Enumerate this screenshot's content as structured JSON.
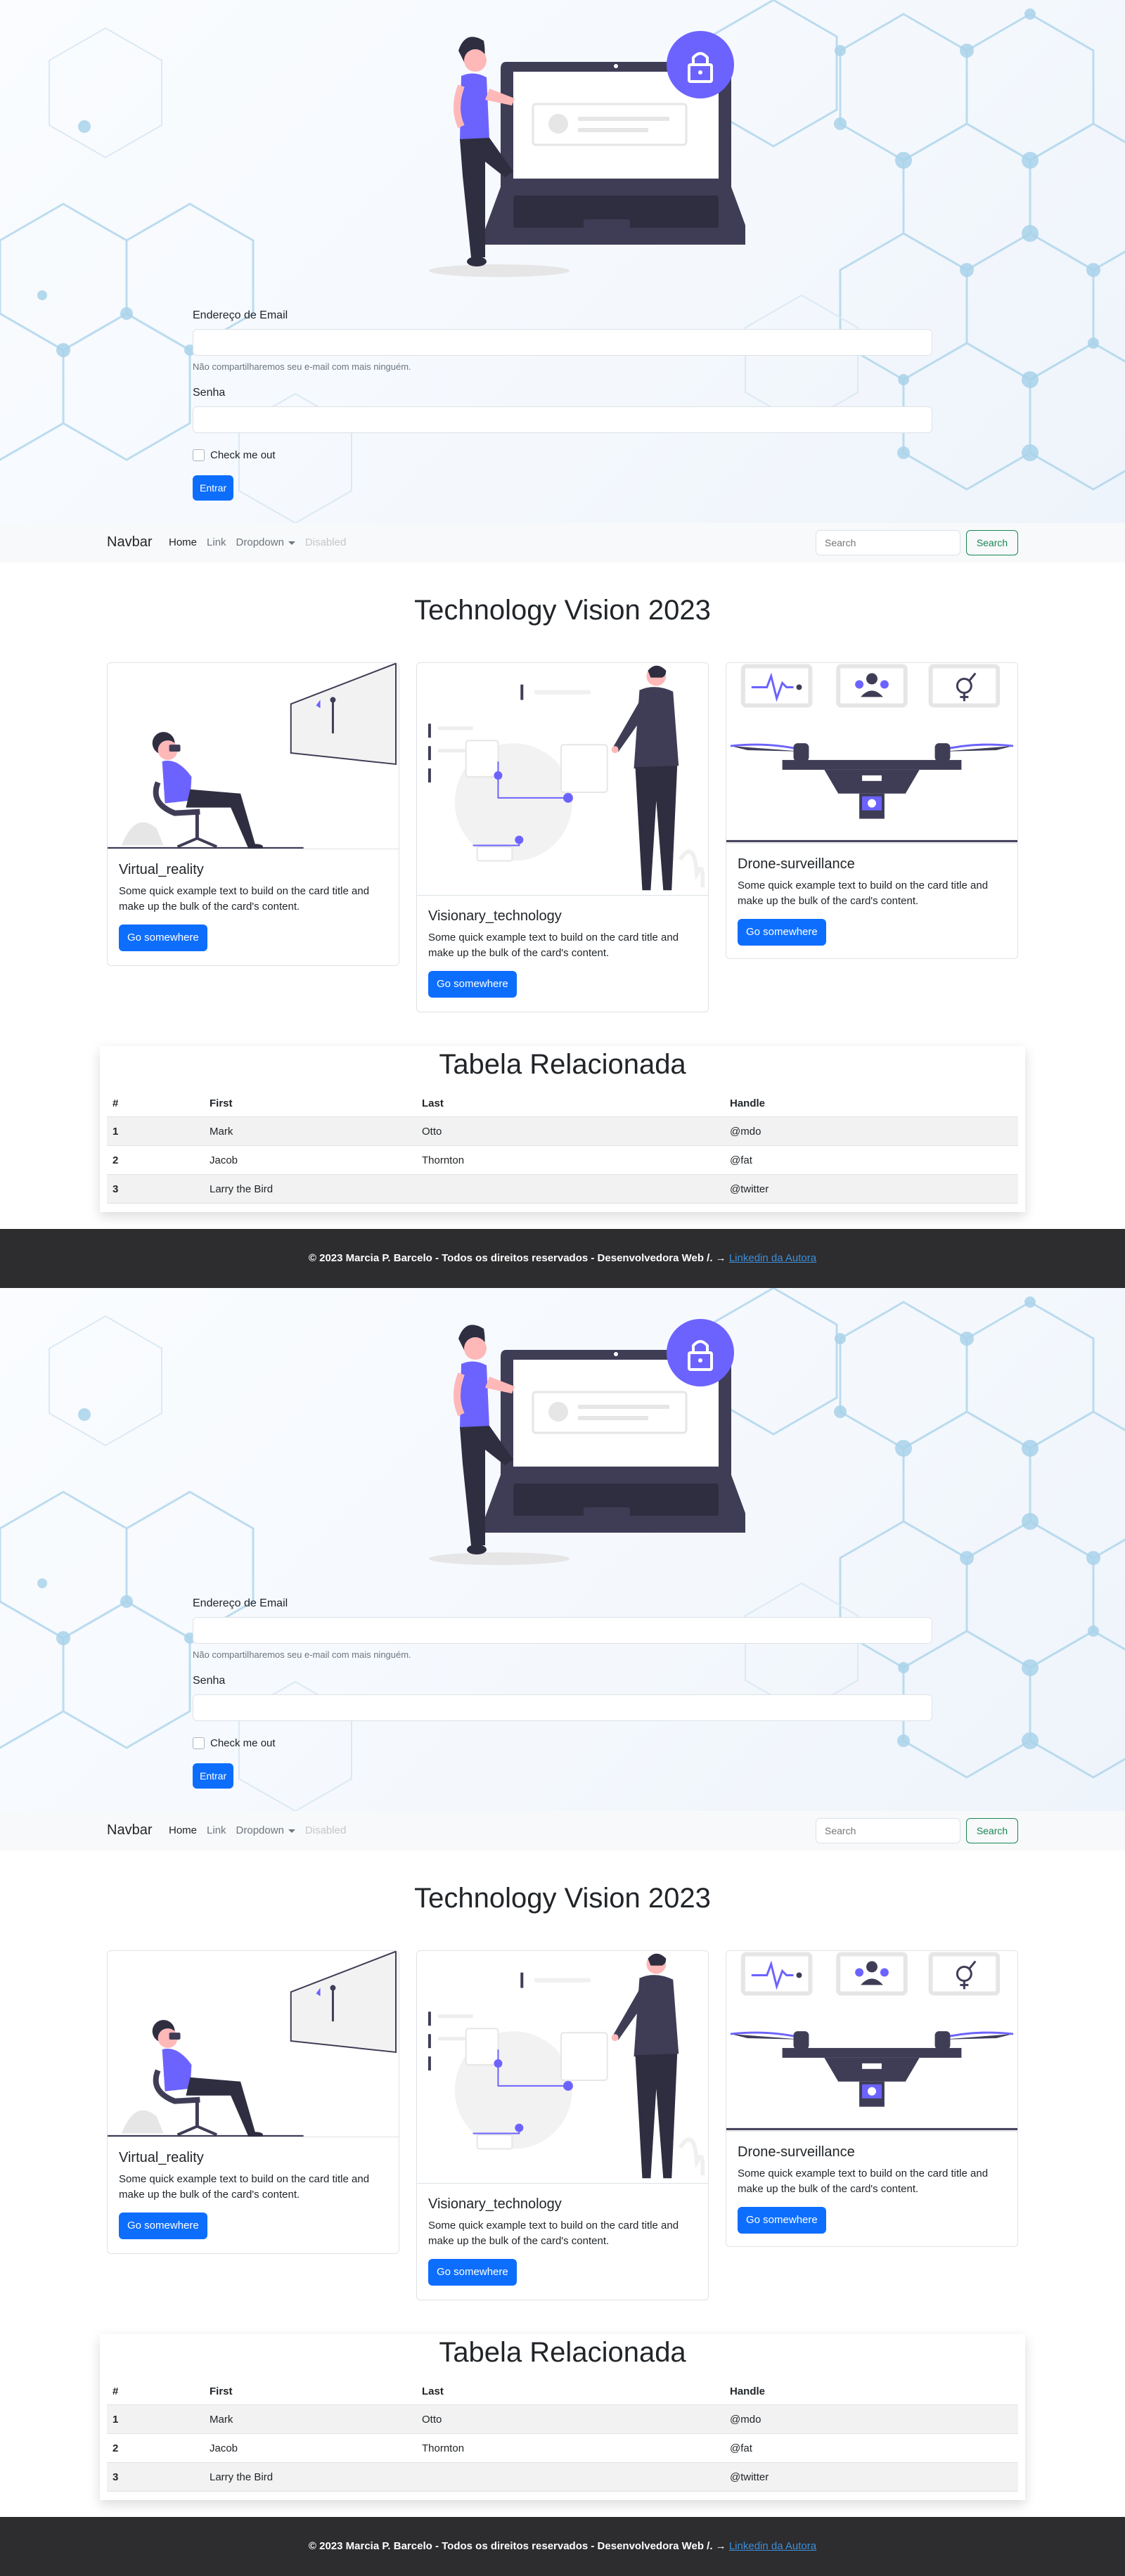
{
  "hero": {
    "email_label": "Endereço de Email",
    "email_value": "",
    "email_help": "Não compartilharemos seu e-mail com mais ninguém.",
    "password_label": "Senha",
    "password_value": "",
    "check_label": "Check me out",
    "submit_label": "Entrar"
  },
  "navbar": {
    "brand": "Navbar",
    "items": [
      {
        "label": "Home",
        "state": "active"
      },
      {
        "label": "Link",
        "state": "normal"
      },
      {
        "label": "Dropdown",
        "state": "dropdown"
      },
      {
        "label": "Disabled",
        "state": "disabled"
      }
    ],
    "search_placeholder": "Search",
    "search_button": "Search"
  },
  "main": {
    "title": "Technology Vision 2023",
    "cards": [
      {
        "title": "Virtual_reality",
        "text": "Some quick example text to build on the card title and make up the bulk of the card's content.",
        "button": "Go somewhere"
      },
      {
        "title": "Visionary_technology",
        "text": "Some quick example text to build on the card title and make up the bulk of the card's content.",
        "button": "Go somewhere"
      },
      {
        "title": "Drone-surveillance",
        "text": "Some quick example text to build on the card title and make up the bulk of the card's content.",
        "button": "Go somewhere"
      }
    ]
  },
  "table": {
    "title": "Tabela Relacionada",
    "headers": [
      "#",
      "First",
      "Last",
      "Handle"
    ],
    "rows": [
      [
        "1",
        "Mark",
        "Otto",
        "@mdo"
      ],
      [
        "2",
        "Jacob",
        "Thornton",
        "@fat"
      ],
      [
        "3",
        "Larry the Bird",
        "",
        "@twitter"
      ]
    ]
  },
  "footer": {
    "text": "© 2023 Marcia P. Barcelo - Todos os direitos reservados - Desenvolvedora Web /. →",
    "link": "Linkedin da Autora"
  },
  "colors": {
    "primary": "#0d6efd",
    "success": "#198754",
    "illustration_accent": "#6c63ff",
    "illustration_dark": "#3f3d56",
    "footer_bg": "#2d2c2e"
  }
}
